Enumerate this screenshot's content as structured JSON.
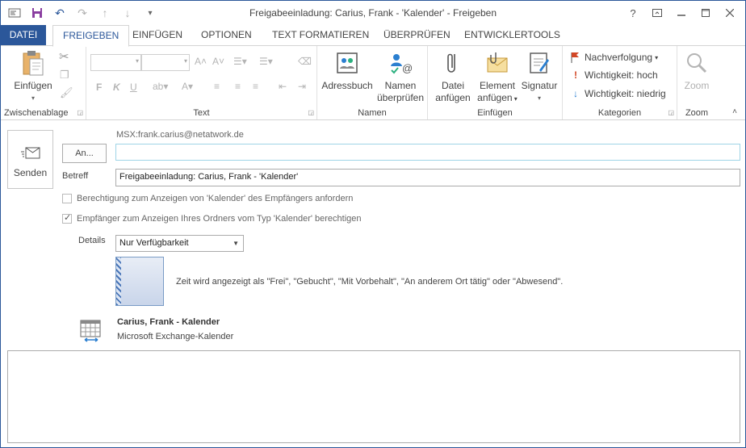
{
  "window": {
    "title": "Freigabeeinladung: Carius, Frank - 'Kalender' - Freigeben",
    "help": "?",
    "controls": [
      "restore-ribbon-icon",
      "minimize-icon",
      "maximize-icon",
      "close-icon"
    ]
  },
  "qat": {
    "items": [
      "mail-icon",
      "save-icon",
      "undo-icon",
      "redo-icon",
      "up-arrow-icon",
      "down-arrow-icon",
      "customize-icon"
    ]
  },
  "tabs": [
    "DATEI",
    "FREIGEBEN",
    "EINFÜGEN",
    "OPTIONEN",
    "TEXT FORMATIEREN",
    "ÜBERPRÜFEN",
    "ENTWICKLERTOOLS"
  ],
  "ribbon": {
    "clipboard": {
      "label": "Zwischenablage",
      "paste": "Einfügen"
    },
    "text": {
      "label": "Text"
    },
    "names": {
      "label": "Namen",
      "addressbook": "Adressbuch",
      "check1": "Namen",
      "check2": "überprüfen"
    },
    "insert": {
      "label": "Einfügen",
      "file1": "Datei",
      "file2": "anfügen",
      "item1": "Element",
      "item2": "anfügen",
      "signature": "Signatur"
    },
    "tags": {
      "label": "Kategorien",
      "followup": "Nachverfolgung",
      "high": "Wichtigkeit: hoch",
      "low": "Wichtigkeit: niedrig"
    },
    "zoom": {
      "label": "Zoom",
      "zoom": "Zoom"
    }
  },
  "form": {
    "send": "Senden",
    "from": "MSX:frank.carius@netatwork.de",
    "to_button": "An...",
    "to_value": "",
    "subject_label": "Betreff",
    "subject_value": "Freigabeeinladung: Carius, Frank - 'Kalender'",
    "check_request": "Berechtigung zum Anzeigen von 'Kalender' des Empfängers anfordern",
    "check_request_checked": false,
    "check_allow": "Empfänger zum Anzeigen Ihres Ordners vom Typ 'Kalender' berechtigen",
    "check_allow_checked": true,
    "details_label": "Details",
    "details_value": "Nur Verfügbarkeit",
    "preview_text": "Zeit wird angezeigt als \"Frei\", \"Gebucht\", \"Mit Vorbehalt\", \"An anderem Ort tätig\" oder \"Abwesend\".",
    "calendar_name": "Carius, Frank - Kalender",
    "calendar_type": "Microsoft Exchange-Kalender"
  }
}
